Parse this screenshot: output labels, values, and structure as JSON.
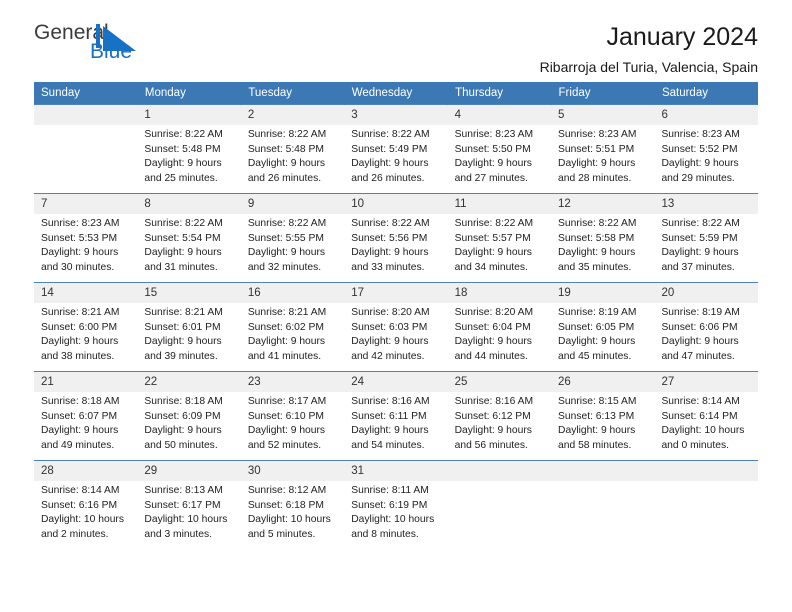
{
  "logo": {
    "word_one": "General",
    "word_two": "Blue",
    "mark_color": "#1771c4"
  },
  "header": {
    "title": "January 2024",
    "subtitle": "Ribarroja del Turia, Valencia, Spain"
  },
  "colors": {
    "header_blue": "#3c78b4",
    "row_divider_blue": "#4d82bb",
    "daynum_bg": "#f0f0f0",
    "logo_blue": "#1771c4",
    "logo_gray": "#3c3c3c"
  },
  "calendar": {
    "weekday_headers": [
      "Sunday",
      "Monday",
      "Tuesday",
      "Wednesday",
      "Thursday",
      "Friday",
      "Saturday"
    ],
    "weeks": [
      [
        {
          "day": "",
          "sunrise": "",
          "sunset": "",
          "daylight": ""
        },
        {
          "day": "1",
          "sunrise": "Sunrise: 8:22 AM",
          "sunset": "Sunset: 5:48 PM",
          "daylight": "Daylight: 9 hours and 25 minutes."
        },
        {
          "day": "2",
          "sunrise": "Sunrise: 8:22 AM",
          "sunset": "Sunset: 5:48 PM",
          "daylight": "Daylight: 9 hours and 26 minutes."
        },
        {
          "day": "3",
          "sunrise": "Sunrise: 8:22 AM",
          "sunset": "Sunset: 5:49 PM",
          "daylight": "Daylight: 9 hours and 26 minutes."
        },
        {
          "day": "4",
          "sunrise": "Sunrise: 8:23 AM",
          "sunset": "Sunset: 5:50 PM",
          "daylight": "Daylight: 9 hours and 27 minutes."
        },
        {
          "day": "5",
          "sunrise": "Sunrise: 8:23 AM",
          "sunset": "Sunset: 5:51 PM",
          "daylight": "Daylight: 9 hours and 28 minutes."
        },
        {
          "day": "6",
          "sunrise": "Sunrise: 8:23 AM",
          "sunset": "Sunset: 5:52 PM",
          "daylight": "Daylight: 9 hours and 29 minutes."
        }
      ],
      [
        {
          "day": "7",
          "sunrise": "Sunrise: 8:23 AM",
          "sunset": "Sunset: 5:53 PM",
          "daylight": "Daylight: 9 hours and 30 minutes."
        },
        {
          "day": "8",
          "sunrise": "Sunrise: 8:22 AM",
          "sunset": "Sunset: 5:54 PM",
          "daylight": "Daylight: 9 hours and 31 minutes."
        },
        {
          "day": "9",
          "sunrise": "Sunrise: 8:22 AM",
          "sunset": "Sunset: 5:55 PM",
          "daylight": "Daylight: 9 hours and 32 minutes."
        },
        {
          "day": "10",
          "sunrise": "Sunrise: 8:22 AM",
          "sunset": "Sunset: 5:56 PM",
          "daylight": "Daylight: 9 hours and 33 minutes."
        },
        {
          "day": "11",
          "sunrise": "Sunrise: 8:22 AM",
          "sunset": "Sunset: 5:57 PM",
          "daylight": "Daylight: 9 hours and 34 minutes."
        },
        {
          "day": "12",
          "sunrise": "Sunrise: 8:22 AM",
          "sunset": "Sunset: 5:58 PM",
          "daylight": "Daylight: 9 hours and 35 minutes."
        },
        {
          "day": "13",
          "sunrise": "Sunrise: 8:22 AM",
          "sunset": "Sunset: 5:59 PM",
          "daylight": "Daylight: 9 hours and 37 minutes."
        }
      ],
      [
        {
          "day": "14",
          "sunrise": "Sunrise: 8:21 AM",
          "sunset": "Sunset: 6:00 PM",
          "daylight": "Daylight: 9 hours and 38 minutes."
        },
        {
          "day": "15",
          "sunrise": "Sunrise: 8:21 AM",
          "sunset": "Sunset: 6:01 PM",
          "daylight": "Daylight: 9 hours and 39 minutes."
        },
        {
          "day": "16",
          "sunrise": "Sunrise: 8:21 AM",
          "sunset": "Sunset: 6:02 PM",
          "daylight": "Daylight: 9 hours and 41 minutes."
        },
        {
          "day": "17",
          "sunrise": "Sunrise: 8:20 AM",
          "sunset": "Sunset: 6:03 PM",
          "daylight": "Daylight: 9 hours and 42 minutes."
        },
        {
          "day": "18",
          "sunrise": "Sunrise: 8:20 AM",
          "sunset": "Sunset: 6:04 PM",
          "daylight": "Daylight: 9 hours and 44 minutes."
        },
        {
          "day": "19",
          "sunrise": "Sunrise: 8:19 AM",
          "sunset": "Sunset: 6:05 PM",
          "daylight": "Daylight: 9 hours and 45 minutes."
        },
        {
          "day": "20",
          "sunrise": "Sunrise: 8:19 AM",
          "sunset": "Sunset: 6:06 PM",
          "daylight": "Daylight: 9 hours and 47 minutes."
        }
      ],
      [
        {
          "day": "21",
          "sunrise": "Sunrise: 8:18 AM",
          "sunset": "Sunset: 6:07 PM",
          "daylight": "Daylight: 9 hours and 49 minutes."
        },
        {
          "day": "22",
          "sunrise": "Sunrise: 8:18 AM",
          "sunset": "Sunset: 6:09 PM",
          "daylight": "Daylight: 9 hours and 50 minutes."
        },
        {
          "day": "23",
          "sunrise": "Sunrise: 8:17 AM",
          "sunset": "Sunset: 6:10 PM",
          "daylight": "Daylight: 9 hours and 52 minutes."
        },
        {
          "day": "24",
          "sunrise": "Sunrise: 8:16 AM",
          "sunset": "Sunset: 6:11 PM",
          "daylight": "Daylight: 9 hours and 54 minutes."
        },
        {
          "day": "25",
          "sunrise": "Sunrise: 8:16 AM",
          "sunset": "Sunset: 6:12 PM",
          "daylight": "Daylight: 9 hours and 56 minutes."
        },
        {
          "day": "26",
          "sunrise": "Sunrise: 8:15 AM",
          "sunset": "Sunset: 6:13 PM",
          "daylight": "Daylight: 9 hours and 58 minutes."
        },
        {
          "day": "27",
          "sunrise": "Sunrise: 8:14 AM",
          "sunset": "Sunset: 6:14 PM",
          "daylight": "Daylight: 10 hours and 0 minutes."
        }
      ],
      [
        {
          "day": "28",
          "sunrise": "Sunrise: 8:14 AM",
          "sunset": "Sunset: 6:16 PM",
          "daylight": "Daylight: 10 hours and 2 minutes."
        },
        {
          "day": "29",
          "sunrise": "Sunrise: 8:13 AM",
          "sunset": "Sunset: 6:17 PM",
          "daylight": "Daylight: 10 hours and 3 minutes."
        },
        {
          "day": "30",
          "sunrise": "Sunrise: 8:12 AM",
          "sunset": "Sunset: 6:18 PM",
          "daylight": "Daylight: 10 hours and 5 minutes."
        },
        {
          "day": "31",
          "sunrise": "Sunrise: 8:11 AM",
          "sunset": "Sunset: 6:19 PM",
          "daylight": "Daylight: 10 hours and 8 minutes."
        },
        {
          "day": "",
          "sunrise": "",
          "sunset": "",
          "daylight": ""
        },
        {
          "day": "",
          "sunrise": "",
          "sunset": "",
          "daylight": ""
        },
        {
          "day": "",
          "sunrise": "",
          "sunset": "",
          "daylight": ""
        }
      ]
    ]
  }
}
